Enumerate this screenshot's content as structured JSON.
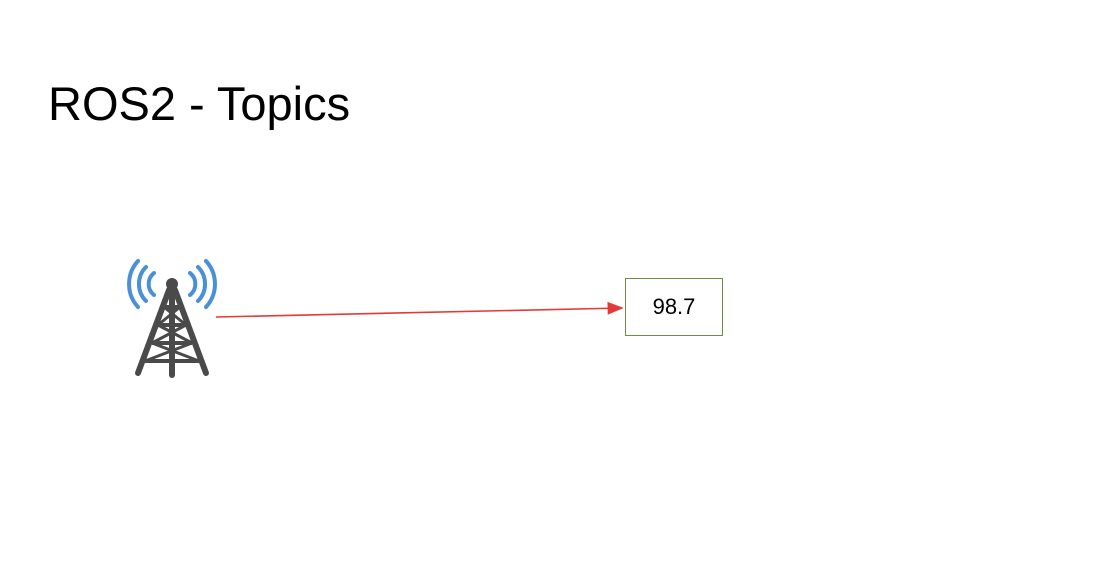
{
  "slide": {
    "title": "ROS2 - Topics"
  },
  "diagram": {
    "source_icon": "radio-tower-icon",
    "topic_box_label": "98.7",
    "arrow_color": "#e53935",
    "wave_color": "#4a90d9",
    "tower_color": "#4a4a4a",
    "box_border_color": "#6b8f3e"
  }
}
